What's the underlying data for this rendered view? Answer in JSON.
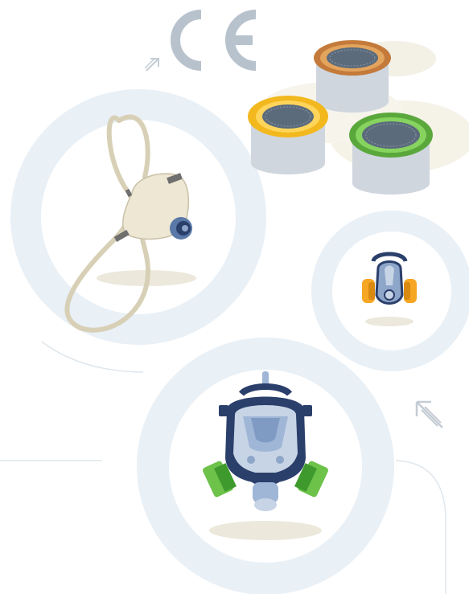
{
  "marks": {
    "ce_mark": "CE"
  },
  "colors": {
    "ring": "#e8eff5",
    "line": "#dfe6ec",
    "ce": "#b7c2cd",
    "arrow": "#c4ccd4",
    "shadow": "#ece8dc",
    "filter_brown": "#c47a3a",
    "filter_yellow": "#f2b81d",
    "filter_green": "#5aa83c",
    "mask_navy": "#2b3f6b",
    "mask_green": "#6dc24a",
    "half_mask_orange": "#f5a623"
  },
  "icons": [
    "ce-mark-icon",
    "arrow-up-right-icon",
    "arrow-up-left-icon",
    "filter-cartridge-brown-icon",
    "filter-cartridge-yellow-icon",
    "filter-cartridge-green-icon",
    "supplied-air-mask-icon",
    "half-mask-respirator-icon",
    "full-face-respirator-icon"
  ]
}
